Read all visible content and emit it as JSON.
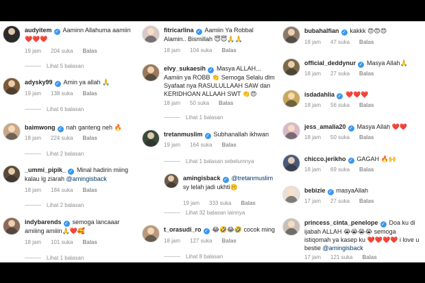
{
  "labels": {
    "likes_suffix": "suka",
    "reply": "Balas"
  },
  "columns": [
    {
      "comments": [
        {
          "username": "audyitem",
          "verified": true,
          "text": "Aaminn Allahuma aamiin ❤️❤️❤️",
          "time": "19 jam",
          "likes": "204 suka",
          "reply": "Balas",
          "avatar_color": "#2b2b2b"
        },
        {
          "thread": "Lihat 5 balasan"
        },
        {
          "username": "adysky99",
          "verified": true,
          "text": "Amin ya allah 🙏",
          "time": "19 jam",
          "likes": "138 suka",
          "reply": "Balas",
          "avatar_color": "#7a5a3a"
        },
        {
          "thread": "Lihat 6 balasan"
        },
        {
          "username": "baimwong",
          "verified": true,
          "text": "nah ganteng neh 🔥",
          "time": "18 jam",
          "likes": "224 suka",
          "reply": "Balas",
          "avatar_color": "#c8a88a"
        },
        {
          "thread": "Lihat 2 balasan"
        },
        {
          "username": "_ummi_pipik_",
          "verified": true,
          "text": "Minal hadirin miing kalau lg ziarah @amingisback",
          "mention": "@amingisback",
          "time": "18 jam",
          "likes": "184 suka",
          "reply": "Balas",
          "avatar_color": "#5a4a3a"
        },
        {
          "thread": "Lihat 2 balasan"
        },
        {
          "username": "indybarends",
          "verified": true,
          "text": "semoga lancaaar amiiing amiiin🙏❤️🥰",
          "time": "18 jam",
          "likes": "101 suka",
          "reply": "Balas",
          "avatar_color": "#8a6a5a"
        },
        {
          "thread": "Lihat 1 balasan"
        }
      ]
    },
    {
      "comments": [
        {
          "username": "fitricarlina",
          "verified": true,
          "text": "Aamiin Ya Robbal Alamin.. Bismillah 😇😇🙏🙏",
          "time": "18 jam",
          "likes": "104 suka",
          "reply": "Balas",
          "avatar_color": "#d8c8c8"
        },
        {
          "username": "elvy_sukaesih",
          "verified": true,
          "text": "Masya ALLAH... Aamiin ya ROBB 👏 Semoga Selalu dlm Syafaat nya RASULULLAAH SAW dan KERIDHOAN ALLAAH SWT 👏😍",
          "time": "18 jam",
          "likes": "50 suka",
          "reply": "Balas",
          "avatar_color": "#9a7a5a"
        },
        {
          "thread": "Lihat 1 balasan"
        },
        {
          "username": "tretanmuslim",
          "verified": true,
          "text": "Subhanallah ikhwan",
          "time": "19 jam",
          "likes": "164 suka",
          "reply": "Balas",
          "avatar_color": "#3a4a3a"
        },
        {
          "thread": "Lihat 1 balasan sebelumnya"
        },
        {
          "username": "amingisback",
          "verified": true,
          "text": "@tretanmuslim sy lelah jadi ukhti🤫",
          "mention": "@tretanmuslim",
          "time": "19 jam",
          "likes": "333 suka",
          "reply": "Balas",
          "avatar_color": "#6a5a4a",
          "nested": true
        },
        {
          "thread": "Lihat 32 balasan lainnya"
        },
        {
          "username": "t_orasudi_ro",
          "verified": true,
          "text": "😂🤣😂🤣 cocok ming",
          "time": "18 jam",
          "likes": "127 suka",
          "reply": "Balas",
          "avatar_color": "#b89a7a"
        },
        {
          "thread": "Lihat 8 balasan"
        }
      ]
    },
    {
      "comments": [
        {
          "username": "bubahalfian",
          "verified": true,
          "text": "kakkk 😍😍😍",
          "time": "18 jam",
          "likes": "47 suka",
          "reply": "Balas",
          "avatar_color": "#8a7a6a"
        },
        {
          "username": "official_deddynur",
          "verified": true,
          "text": "Masya Allah🙏",
          "time": "18 jam",
          "likes": "27 suka",
          "reply": "Balas",
          "avatar_color": "#7a6a4a"
        },
        {
          "username": "isdadahlia",
          "verified": true,
          "text": "❤️❤️❤️",
          "time": "18 jam",
          "likes": "56 suka",
          "reply": "Balas",
          "avatar_color": "#c8a85a"
        },
        {
          "username": "jess_amalia20",
          "verified": true,
          "text": "Masya Allah ❤️❤️",
          "time": "18 jam",
          "likes": "50 suka",
          "reply": "Balas",
          "avatar_color": "#d8b8c8"
        },
        {
          "username": "chicco.jerikho",
          "verified": true,
          "text": "GAGAH 🔥🙌",
          "time": "18 jam",
          "likes": "69 suka",
          "reply": "Balas",
          "avatar_color": "#4a5a7a"
        },
        {
          "username": "bebizie",
          "verified": true,
          "text": "masyaAllah",
          "time": "17 jam",
          "likes": "27 suka",
          "reply": "Balas",
          "avatar_color": "#e8e0d8"
        },
        {
          "username": "princess_cinta_penelope",
          "verified": true,
          "text": "Doa ku di ijabah ALLAH 😭😭😭😭 semoga istiqomah ya kasep ku ❤️❤️❤️❤️ i love u bestie @amingisback",
          "mention": "@amingisback",
          "time": "17 jam",
          "likes": "121 suka",
          "reply": "Balas",
          "avatar_color": "#c8c0b8"
        }
      ]
    }
  ]
}
